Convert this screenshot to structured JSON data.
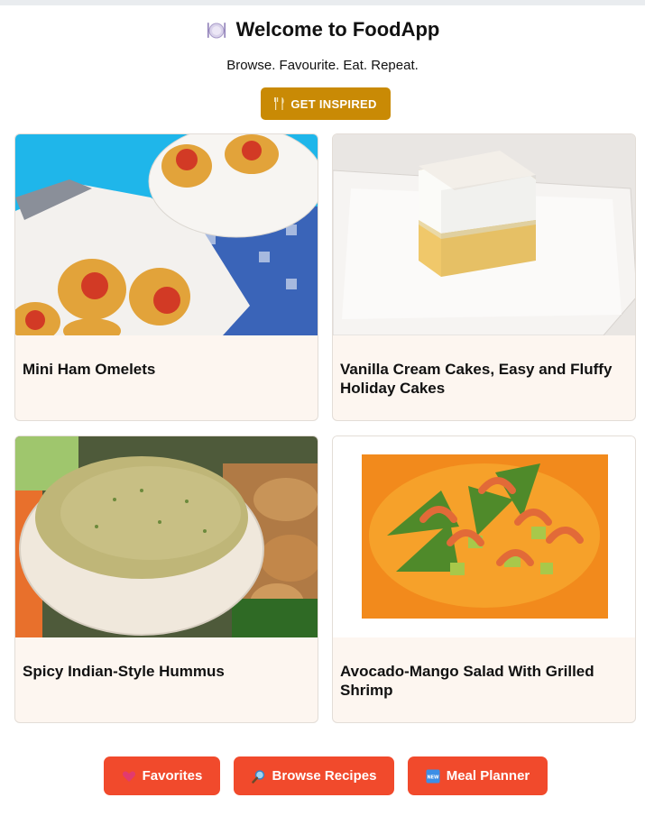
{
  "header": {
    "icon": "plate-fork-knife-icon",
    "title": "Welcome to FoodApp",
    "subtitle": "Browse. Favourite. Eat. Repeat."
  },
  "cta": {
    "icon": "fork-knife-icon",
    "label": "GET INSPIRED",
    "color": "#c98a05"
  },
  "recipes": [
    {
      "title": "Mini Ham Omelets",
      "image": "mini-ham-omelets-photo"
    },
    {
      "title": "Vanilla Cream Cakes, Easy and Fluffy Holiday Cakes",
      "image": "vanilla-cream-cake-photo"
    },
    {
      "title": "Spicy Indian-Style Hummus",
      "image": "hummus-bowl-photo"
    },
    {
      "title": "Avocado-Mango Salad With Grilled Shrimp",
      "image": "shrimp-salad-photo"
    }
  ],
  "nav": {
    "color": "#f14a2c",
    "favorites": {
      "icon": "heart-icon",
      "label": "Favorites"
    },
    "browse": {
      "icon": "magnifier-icon",
      "label": "Browse Recipes"
    },
    "planner": {
      "icon": "new-badge-icon",
      "label": "Meal Planner"
    }
  }
}
